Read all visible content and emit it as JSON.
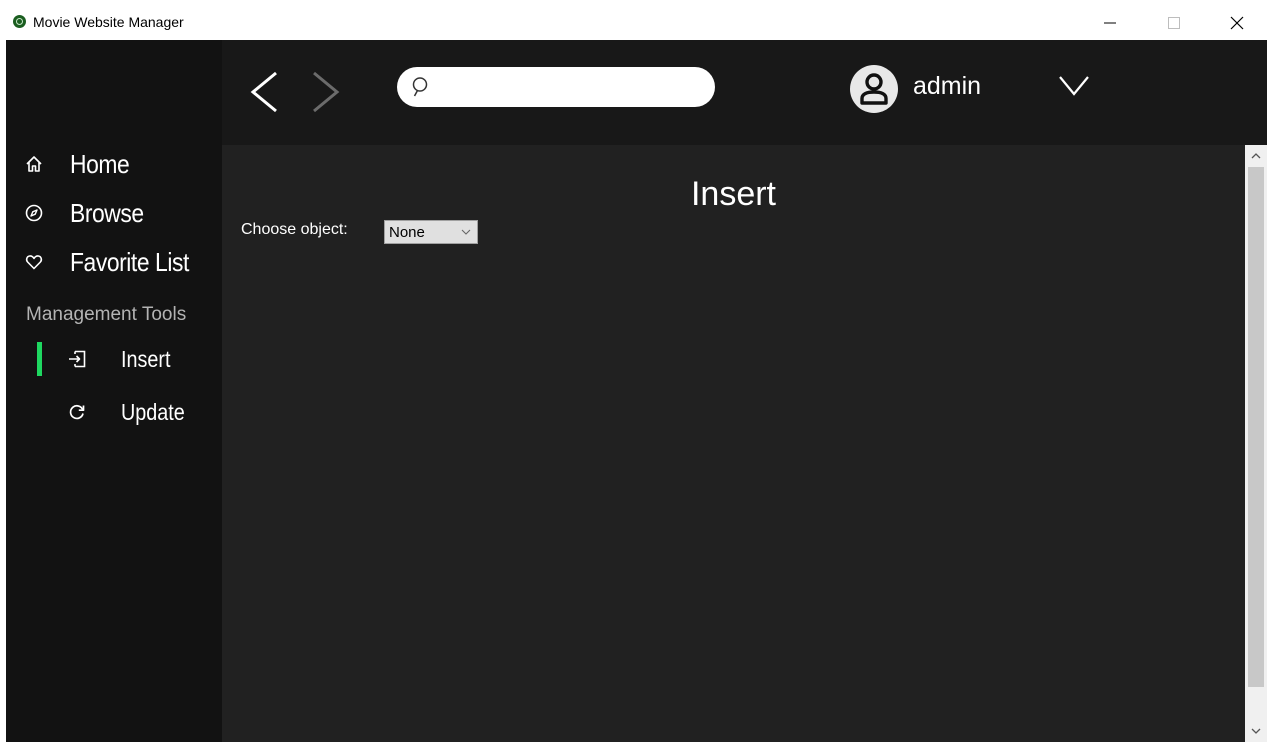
{
  "window": {
    "title": "Movie Website Manager",
    "icon": "app-logo-icon",
    "controls": [
      "minimize-icon",
      "maximize-icon",
      "close-icon"
    ]
  },
  "sidebar": {
    "nav_items": [
      {
        "label": "Home",
        "icon": "home-icon"
      },
      {
        "label": "Browse",
        "icon": "compass-icon"
      },
      {
        "label": "Favorite List",
        "icon": "heart-icon"
      }
    ],
    "section_title": "Management Tools",
    "tools": [
      {
        "label": "Insert",
        "icon": "insert-icon",
        "active": true
      },
      {
        "label": "Update",
        "icon": "refresh-icon",
        "active": false
      }
    ]
  },
  "topbar": {
    "back_icon": "chevron-left-icon",
    "forward_icon": "chevron-right-icon",
    "search": {
      "placeholder": "",
      "value": "",
      "icon": "search-icon"
    },
    "user": {
      "name": "admin",
      "avatar_icon": "user-avatar-icon",
      "menu_icon": "chevron-down-icon"
    }
  },
  "main": {
    "title": "Insert",
    "choose_label": "Choose object:",
    "select_value": "None"
  },
  "colors": {
    "sidebar_bg": "#121212",
    "topbar_bg": "#181818",
    "content_bg": "#212121",
    "accent": "#1ed760"
  }
}
